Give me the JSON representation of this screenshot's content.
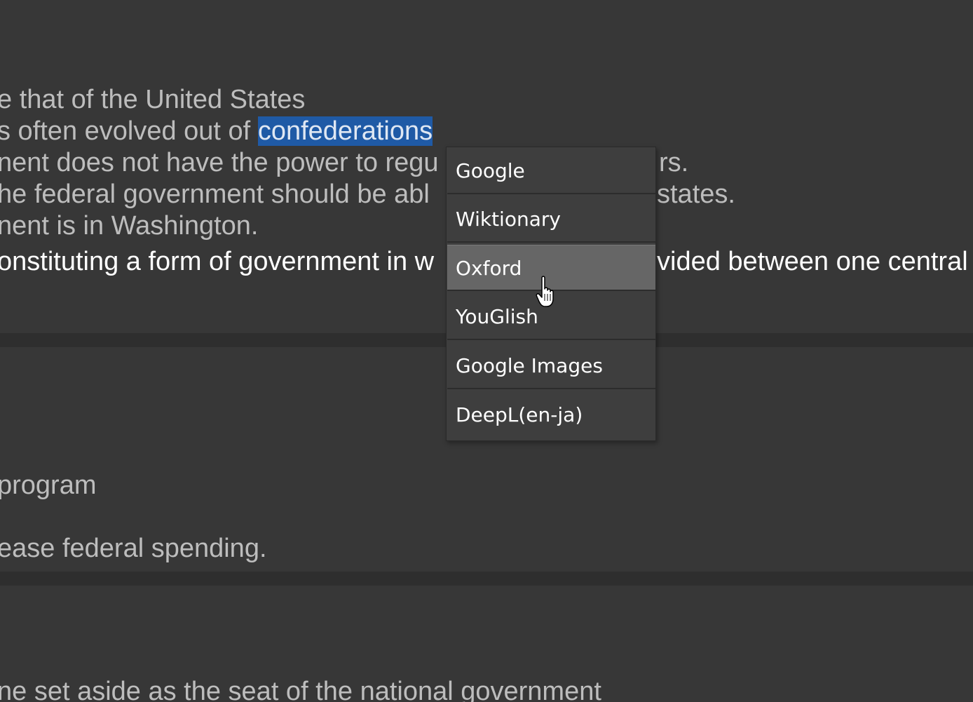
{
  "content": {
    "block1": {
      "line1": "e that of the United States",
      "line2_before": "s often evolved out of ",
      "line2_selected": "confederations",
      "line3_left": "nent does not have the power to regu",
      "line3_right": "rs.",
      "line4_left": "he federal government should be abl",
      "line4_right": "states.",
      "line5": "nent is in Washington.",
      "line6_left": "onstituting a form of government in w",
      "line6_right": "vided between one central"
    },
    "block2": {
      "line1": "program",
      "line2": "ease federal spending."
    },
    "block3": {
      "line1": "ne set aside as the seat of the national government"
    }
  },
  "context_menu": {
    "items": [
      {
        "label": "Google"
      },
      {
        "label": "Wiktionary"
      },
      {
        "label": "Oxford",
        "hovered": true
      },
      {
        "label": "YouGlish"
      },
      {
        "label": "Google Images"
      },
      {
        "label": "DeepL(en-ja)"
      }
    ]
  },
  "colors": {
    "background": "#373737",
    "divider": "#2e2e2e",
    "text_dim": "#bdbdbd",
    "text_bright": "#ffffff",
    "selection": "#1f5aa6",
    "menu_background": "#3e3e3e",
    "menu_hover": "#666666"
  },
  "icons": {
    "cursor": "hand-pointer-icon"
  }
}
